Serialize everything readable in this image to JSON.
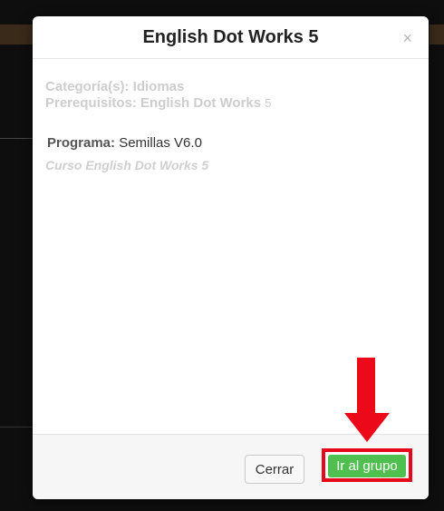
{
  "modal": {
    "title": "English Dot Works 5",
    "close_icon": "close-icon",
    "category": "Categoría(s): Idiomas",
    "prerequisites": "Prerequisitos: English Dot Works",
    "prerequisites_count": "5",
    "program_label": "Programa:",
    "program_value": "Semillas V6.0",
    "course_description": "Curso English Dot Works 5"
  },
  "footer": {
    "close_label": "Cerrar",
    "go_label": "Ir al grupo"
  },
  "annotation": {
    "arrow_icon": "arrow-down-icon",
    "highlight_color": "#e6071b"
  },
  "colors": {
    "primary_button": "#4fbf4f",
    "annotation_red": "#ec0a1a"
  }
}
